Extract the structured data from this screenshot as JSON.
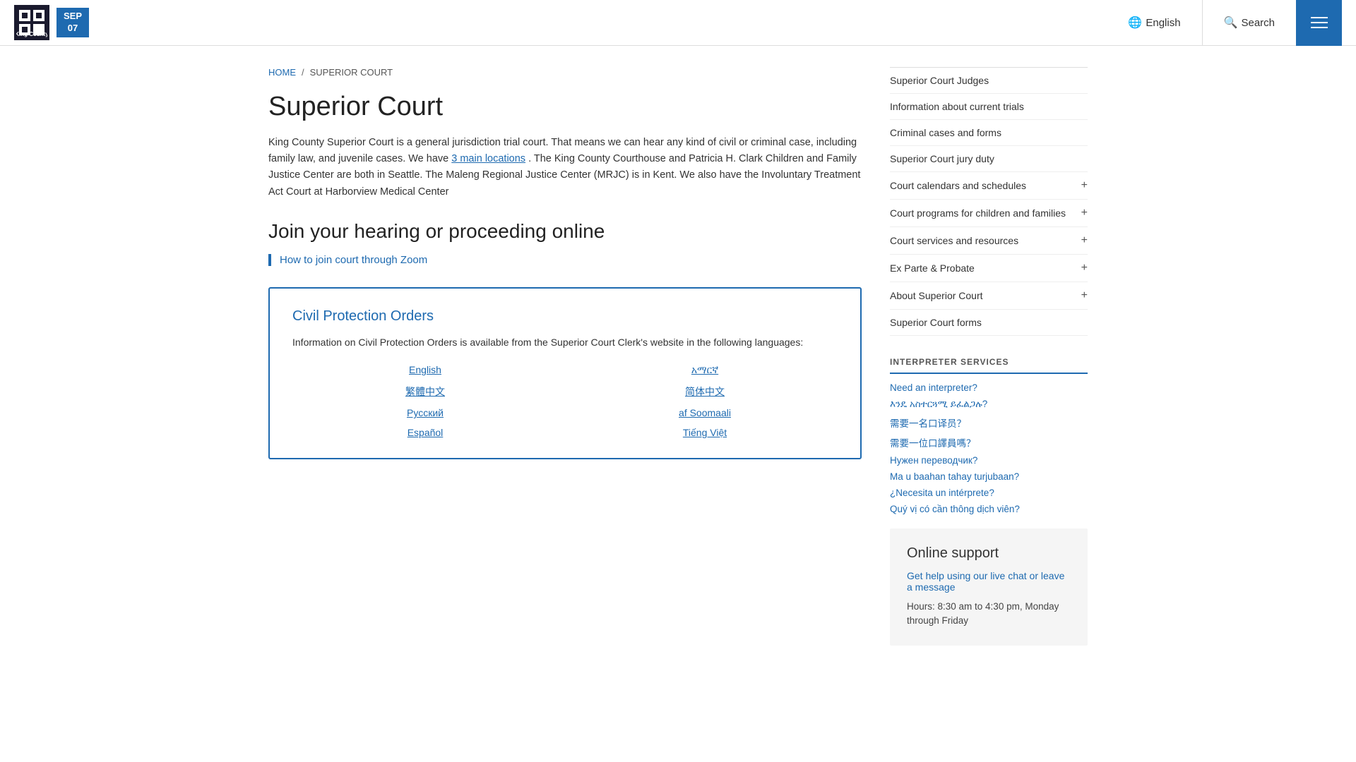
{
  "header": {
    "logo_text": "King County",
    "date_month": "SEP",
    "date_day": "07",
    "lang_label": "English",
    "search_label": "Search"
  },
  "breadcrumb": {
    "home_label": "HOME",
    "separator": "/",
    "current": "SUPERIOR COURT"
  },
  "main": {
    "page_title": "Superior Court",
    "description": "King County Superior Court is a general jurisdiction trial court. That means we can hear any kind of civil or criminal case, including family law, and juvenile cases. We have",
    "description_link": "3 main locations",
    "description_cont": ". The King County Courthouse and Patricia H. Clark Children and Family Justice Center are both in Seattle. The Maleng Regional Justice Center (MRJC) is in Kent. We also have the Involuntary Treatment Act Court at Harborview Medical Center",
    "section_title": "Join your hearing or proceeding online",
    "zoom_link": "How to join court through Zoom",
    "cpo": {
      "title": "Civil Protection Orders",
      "description": "Information on Civil Protection Orders is available from the Superior Court Clerk's website in the following languages:",
      "languages": [
        {
          "label": "English",
          "col": 1
        },
        {
          "label": "አማርኛ",
          "col": 2
        },
        {
          "label": "繁體中文",
          "col": 1
        },
        {
          "label": "简体中文",
          "col": 2
        },
        {
          "label": "Русский",
          "col": 1
        },
        {
          "label": "af Soomaali",
          "col": 2
        },
        {
          "label": "Español",
          "col": 1
        },
        {
          "label": "Tiếng Việt",
          "col": 2
        }
      ]
    }
  },
  "sidebar": {
    "nav_items": [
      {
        "label": "Superior Court Judges",
        "has_plus": false
      },
      {
        "label": "Information about current trials",
        "has_plus": false
      },
      {
        "label": "Criminal cases and forms",
        "has_plus": false
      },
      {
        "label": "Superior Court jury duty",
        "has_plus": false
      },
      {
        "label": "Court calendars and schedules",
        "has_plus": true
      },
      {
        "label": "Court programs for children and families",
        "has_plus": true
      },
      {
        "label": "Court services and resources",
        "has_plus": true
      },
      {
        "label": "Ex Parte & Probate",
        "has_plus": true
      },
      {
        "label": "About Superior Court",
        "has_plus": true
      },
      {
        "label": "Superior Court forms",
        "has_plus": false
      }
    ],
    "interpreter": {
      "title": "INTERPRETER SERVICES",
      "links": [
        "Need an interpreter?",
        "እንዴ አስተርጓሚ ይፈልጋሉ?",
        "需要一名口译员？",
        "需要一位口譯員嗎？",
        "Нужен переводчик?",
        "Ma u baahan tahay turjubaan?",
        "¿Necesita un intérprete?",
        "Quý vị có cần thông dịch viên?"
      ]
    },
    "online_support": {
      "title": "Online support",
      "link": "Get help using our live chat or leave a message",
      "hours": "Hours: 8:30 am to 4:30 pm, Monday through Friday"
    }
  }
}
